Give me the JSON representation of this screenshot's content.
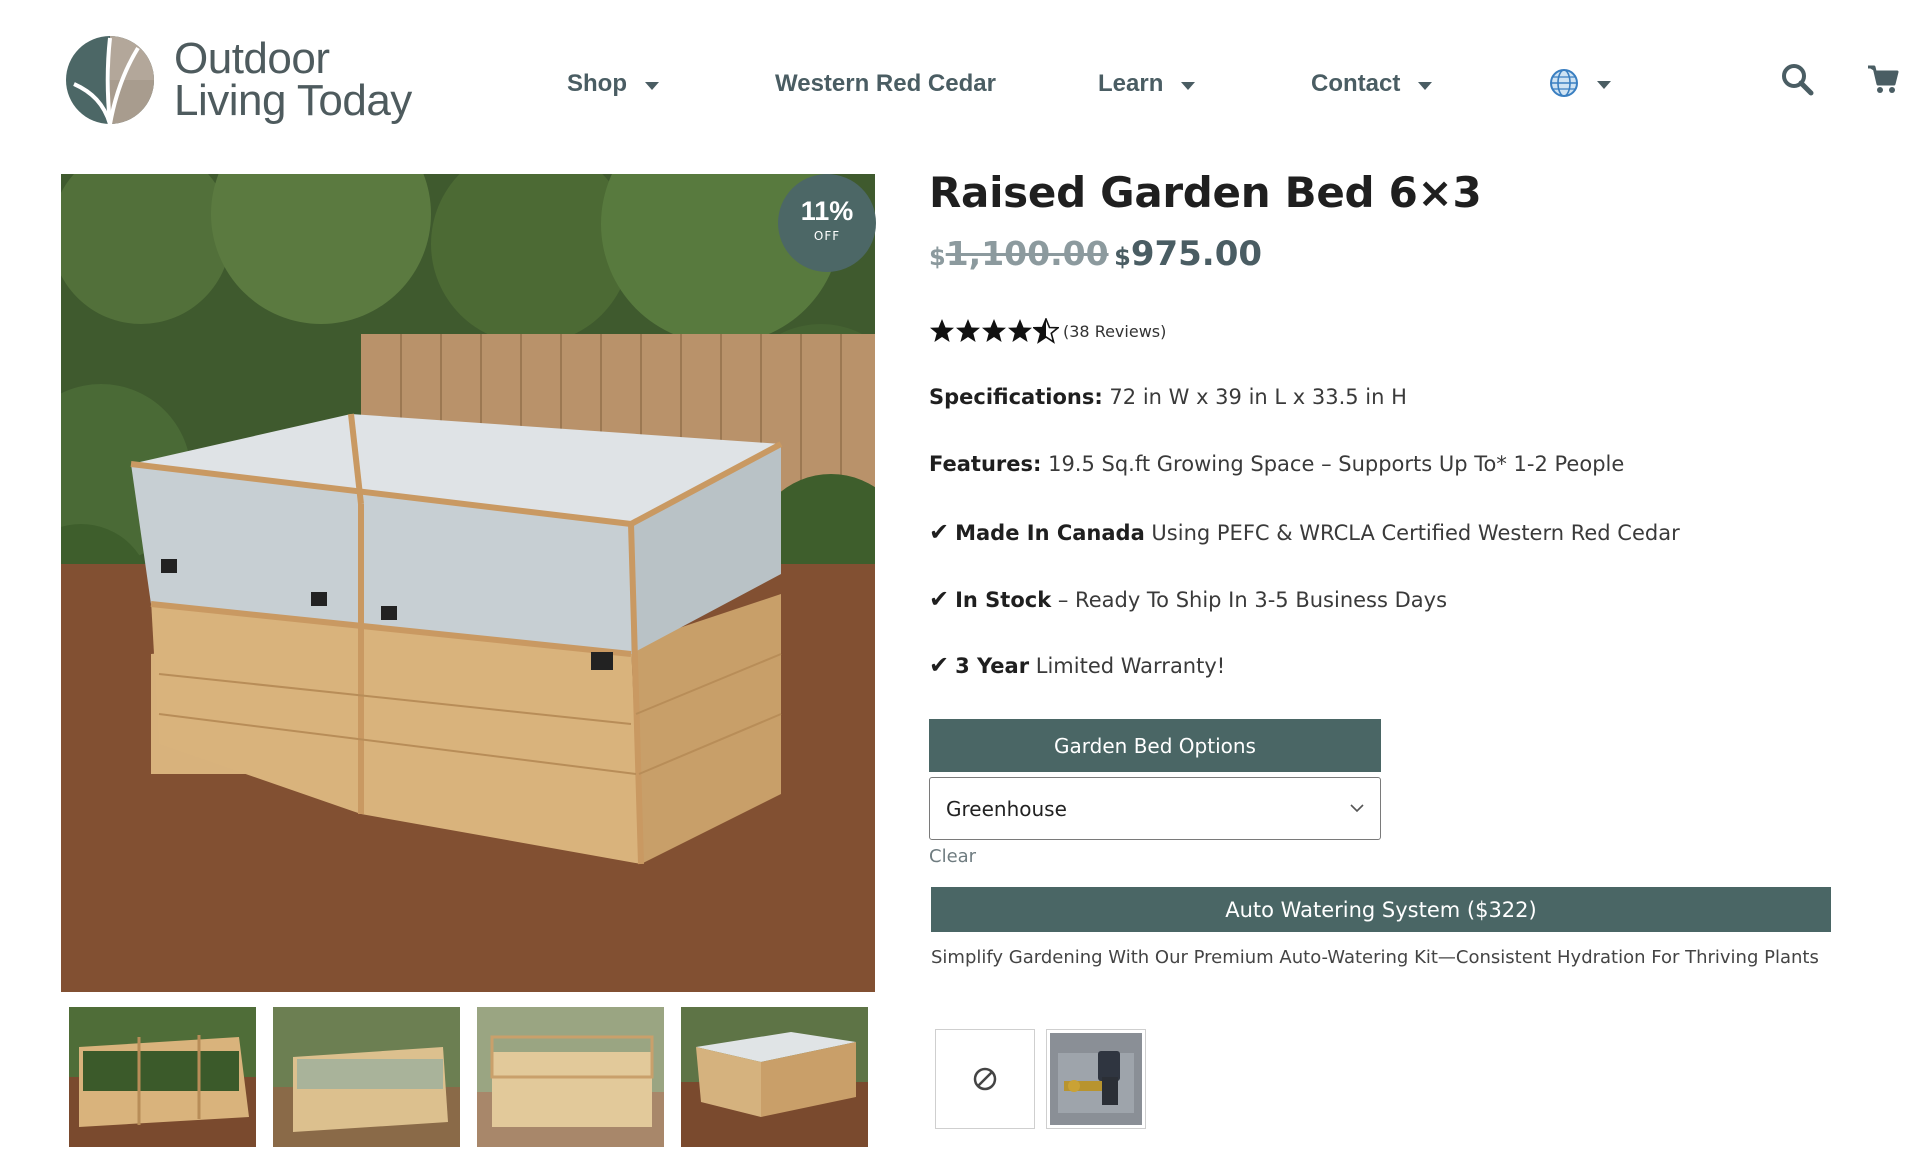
{
  "header": {
    "logo_line1": "Outdoor",
    "logo_line2": "Living Today",
    "nav": [
      {
        "label": "Shop",
        "has_dropdown": true
      },
      {
        "label": "Western Red Cedar",
        "has_dropdown": false
      },
      {
        "label": "Learn",
        "has_dropdown": true
      },
      {
        "label": "Contact",
        "has_dropdown": true
      },
      {
        "label": "",
        "icon": "globe-icon",
        "has_dropdown": true
      }
    ],
    "icons": [
      "search-icon",
      "cart-icon"
    ]
  },
  "gallery": {
    "badge_percent": "11%",
    "badge_label": "OFF",
    "thumbnail_count": 4
  },
  "product": {
    "title": "Raised Garden Bed 6×3",
    "currency_symbol": "$",
    "old_price": "1,100.00",
    "new_price": "975.00",
    "rating": 4.5,
    "reviews_text": "(38 Reviews)",
    "specs": [
      {
        "label": "Specifications:",
        "text": " 72 in W x 39 in L x 33.5 in H",
        "check": false
      },
      {
        "label": "Features:",
        "text": " 19.5 Sq.ft Growing Space – Supports Up To* 1-2 People",
        "check": false
      },
      {
        "label": "Made In Canada",
        "text": " Using PEFC & WRCLA Certified Western Red Cedar",
        "check": true
      },
      {
        "label": "In Stock",
        "text": " – Ready To Ship In 3-5 Business Days",
        "check": true
      },
      {
        "label": "3 Year",
        "text": " Limited Warranty!",
        "check": true
      }
    ],
    "check_mark": "✔"
  },
  "options": {
    "header": "Garden Bed Options",
    "selected": "Greenhouse",
    "clear_label": "Clear"
  },
  "addon": {
    "title": "Auto Watering System ($322)",
    "description": "Simplify Gardening With Our Premium Auto-Watering Kit—Consistent Hydration For Thriving Plants",
    "swatches": [
      "none-icon",
      "watering-kit-image"
    ]
  },
  "colors": {
    "brand_teal": "#4a6665",
    "nav_text": "#4a5d63",
    "badge": "#4c6766"
  }
}
